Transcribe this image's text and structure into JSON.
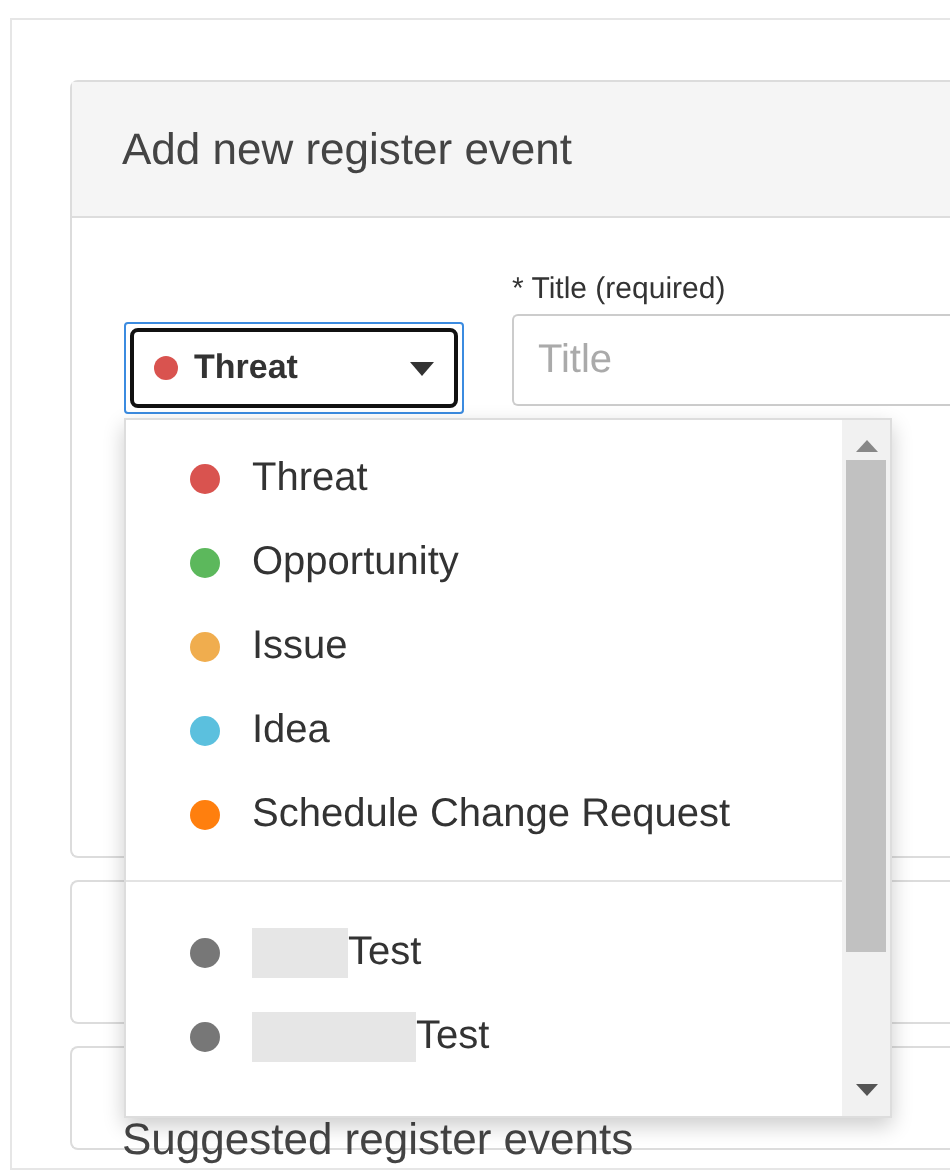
{
  "card": {
    "title": "Add new register event"
  },
  "type_select": {
    "value": "Threat",
    "color": "#d9534f",
    "expanded": true
  },
  "title_field": {
    "label": "* Title (required)",
    "placeholder": "Title"
  },
  "type_options": [
    {
      "label": "Threat",
      "color": "#d9534f"
    },
    {
      "label": "Opportunity",
      "color": "#5cb85c"
    },
    {
      "label": "Issue",
      "color": "#f0ad4e"
    },
    {
      "label": "Idea",
      "color": "#5bc0de"
    },
    {
      "label": "Schedule Change Request",
      "color": "#ff7f0e"
    }
  ],
  "custom_options": [
    {
      "label": "Test",
      "color": "#777777",
      "redacted": true
    },
    {
      "label": "Test",
      "color": "#777777",
      "redacted": true
    }
  ],
  "next_section": {
    "title": "Suggested register events"
  }
}
